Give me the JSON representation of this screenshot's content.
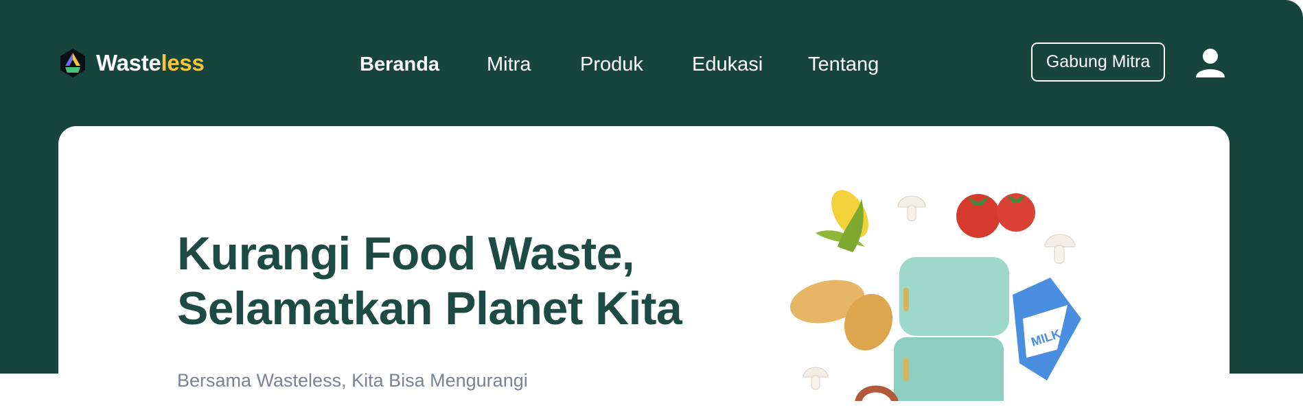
{
  "brand": {
    "name_main": "Waste",
    "name_accent": "less",
    "accent_color": "#F5C63C"
  },
  "nav": {
    "items": [
      {
        "label": "Beranda",
        "active": true
      },
      {
        "label": "Mitra",
        "active": false
      },
      {
        "label": "Produk",
        "active": false
      },
      {
        "label": "Edukasi",
        "active": false
      },
      {
        "label": "Tentang",
        "active": false
      }
    ]
  },
  "header": {
    "join_button": "Gabung Mitra",
    "user_icon": "user-icon",
    "background": "#17453D"
  },
  "hero": {
    "title_line1": "Kurangi Food Waste,",
    "title_line2": "Selamatkan Planet Kita",
    "subtitle": "Bersama Wasteless, Kita Bisa Mengurangi",
    "title_color": "#1D4A42",
    "illustration": "food-fridge-illustration",
    "milk_label": "MILK"
  }
}
